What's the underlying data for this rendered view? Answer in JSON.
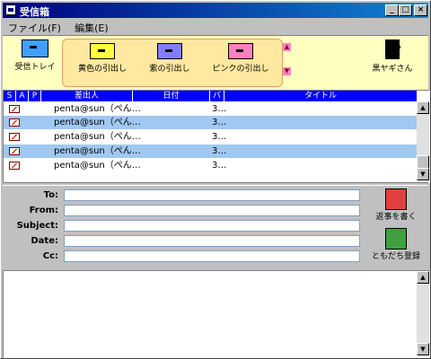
{
  "window": {
    "title": "受信箱"
  },
  "menu": [
    {
      "label": "ファイル(F)"
    },
    {
      "label": "編集(E)"
    }
  ],
  "toolbar": {
    "inbox": "受信トレイ",
    "drawers": [
      {
        "label": "黄色の引出し",
        "color": "#ffff40"
      },
      {
        "label": "紫の引出し",
        "color": "#8080ff"
      },
      {
        "label": "ピンクの引出し",
        "color": "#ff80c0"
      }
    ],
    "goat": "黒ヤギさん"
  },
  "list": {
    "columns": [
      {
        "label": "S"
      },
      {
        "label": "A"
      },
      {
        "label": "P"
      },
      {
        "label": "差出人"
      },
      {
        "label": "日付"
      },
      {
        "label": "バ"
      },
      {
        "label": "タイトル"
      }
    ],
    "rows": [
      {
        "from": "penta@sun（ぺん…",
        "size": "3…"
      },
      {
        "from": "penta@sun（ぺん…",
        "size": "3…"
      },
      {
        "from": "penta@sun（ぺん…",
        "size": "3…"
      },
      {
        "from": "penta@sun（ぺん…",
        "size": "3…"
      },
      {
        "from": "penta@sun（ぺん…",
        "size": "3…"
      }
    ]
  },
  "fields": {
    "to": "To:",
    "from": "From:",
    "subject": "Subject:",
    "date": "Date:",
    "cc": "Cc:"
  },
  "actions": {
    "compose": "返事を書く",
    "register": "ともだち登録"
  }
}
